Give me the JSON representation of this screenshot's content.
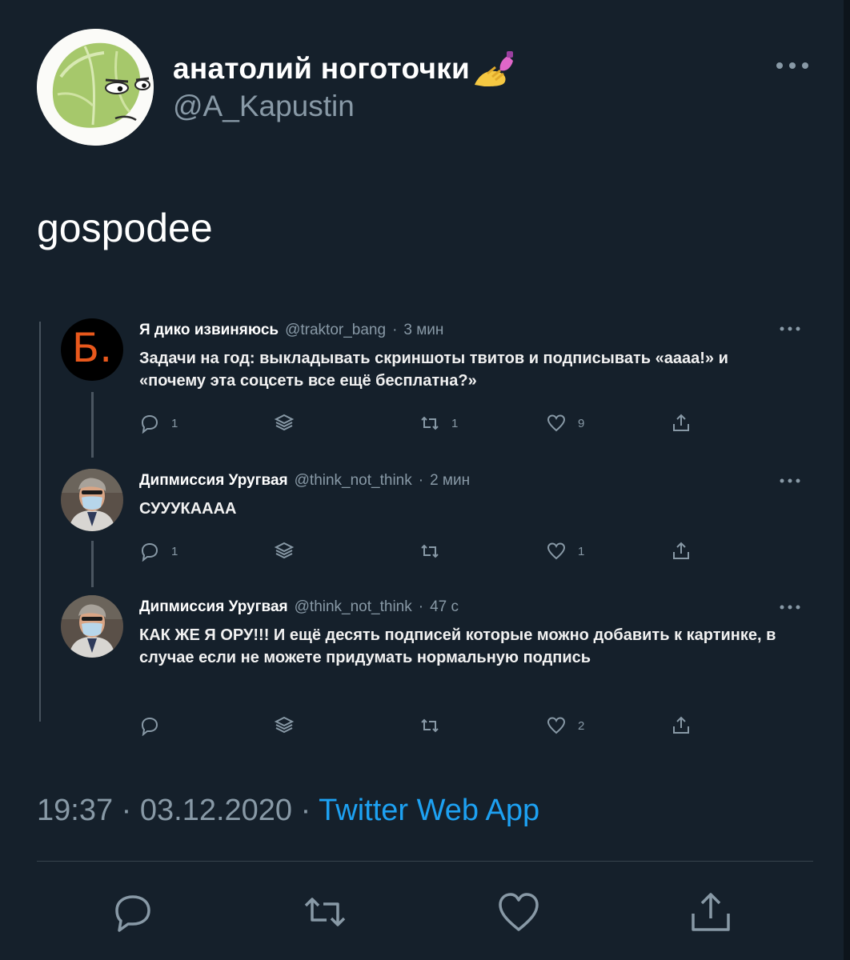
{
  "author": {
    "name": "анатолий ноготочки",
    "handle": "@A_Kapustin",
    "avatar_icon": "cabbage-face-icon",
    "name_emoji": "nail-polish-icon"
  },
  "tweet": {
    "text": "gospodee",
    "time": "19:37",
    "date": "03.12.2020",
    "separator": "·",
    "source": "Twitter Web App"
  },
  "embedded": [
    {
      "avatar_letter": "Б.",
      "name": "Я дико извиняюсь",
      "handle": "@traktor_bang",
      "time": "3 мин",
      "text": "Задачи на год: выкладывать скриншоты твитов и подписывать «аааа!» и «почему эта соцсеть все ещё бесплатна?»",
      "replies": "1",
      "retweets": "1",
      "likes": "9"
    },
    {
      "name": "Дипмиссия Уругвая",
      "handle": "@think_not_think",
      "time": "2 мин",
      "text": "СУУУКАААА",
      "replies": "1",
      "retweets": "",
      "likes": "1"
    },
    {
      "name": "Дипмиссия Уругвая",
      "handle": "@think_not_think",
      "time": "47 с",
      "text": "КАК ЖЕ Я ОРУ!!! И ещё десять подписей которые можно добавить к картинке, в случае если не можете придумать нормальную подпись",
      "replies": "",
      "retweets": "",
      "likes": "2"
    }
  ],
  "colors": {
    "background": "#15202b",
    "secondary_text": "#8899a6",
    "link": "#1da1f2",
    "divider": "#38444d"
  },
  "actions": [
    "reply-icon",
    "retweet-icon",
    "like-icon",
    "share-icon"
  ]
}
